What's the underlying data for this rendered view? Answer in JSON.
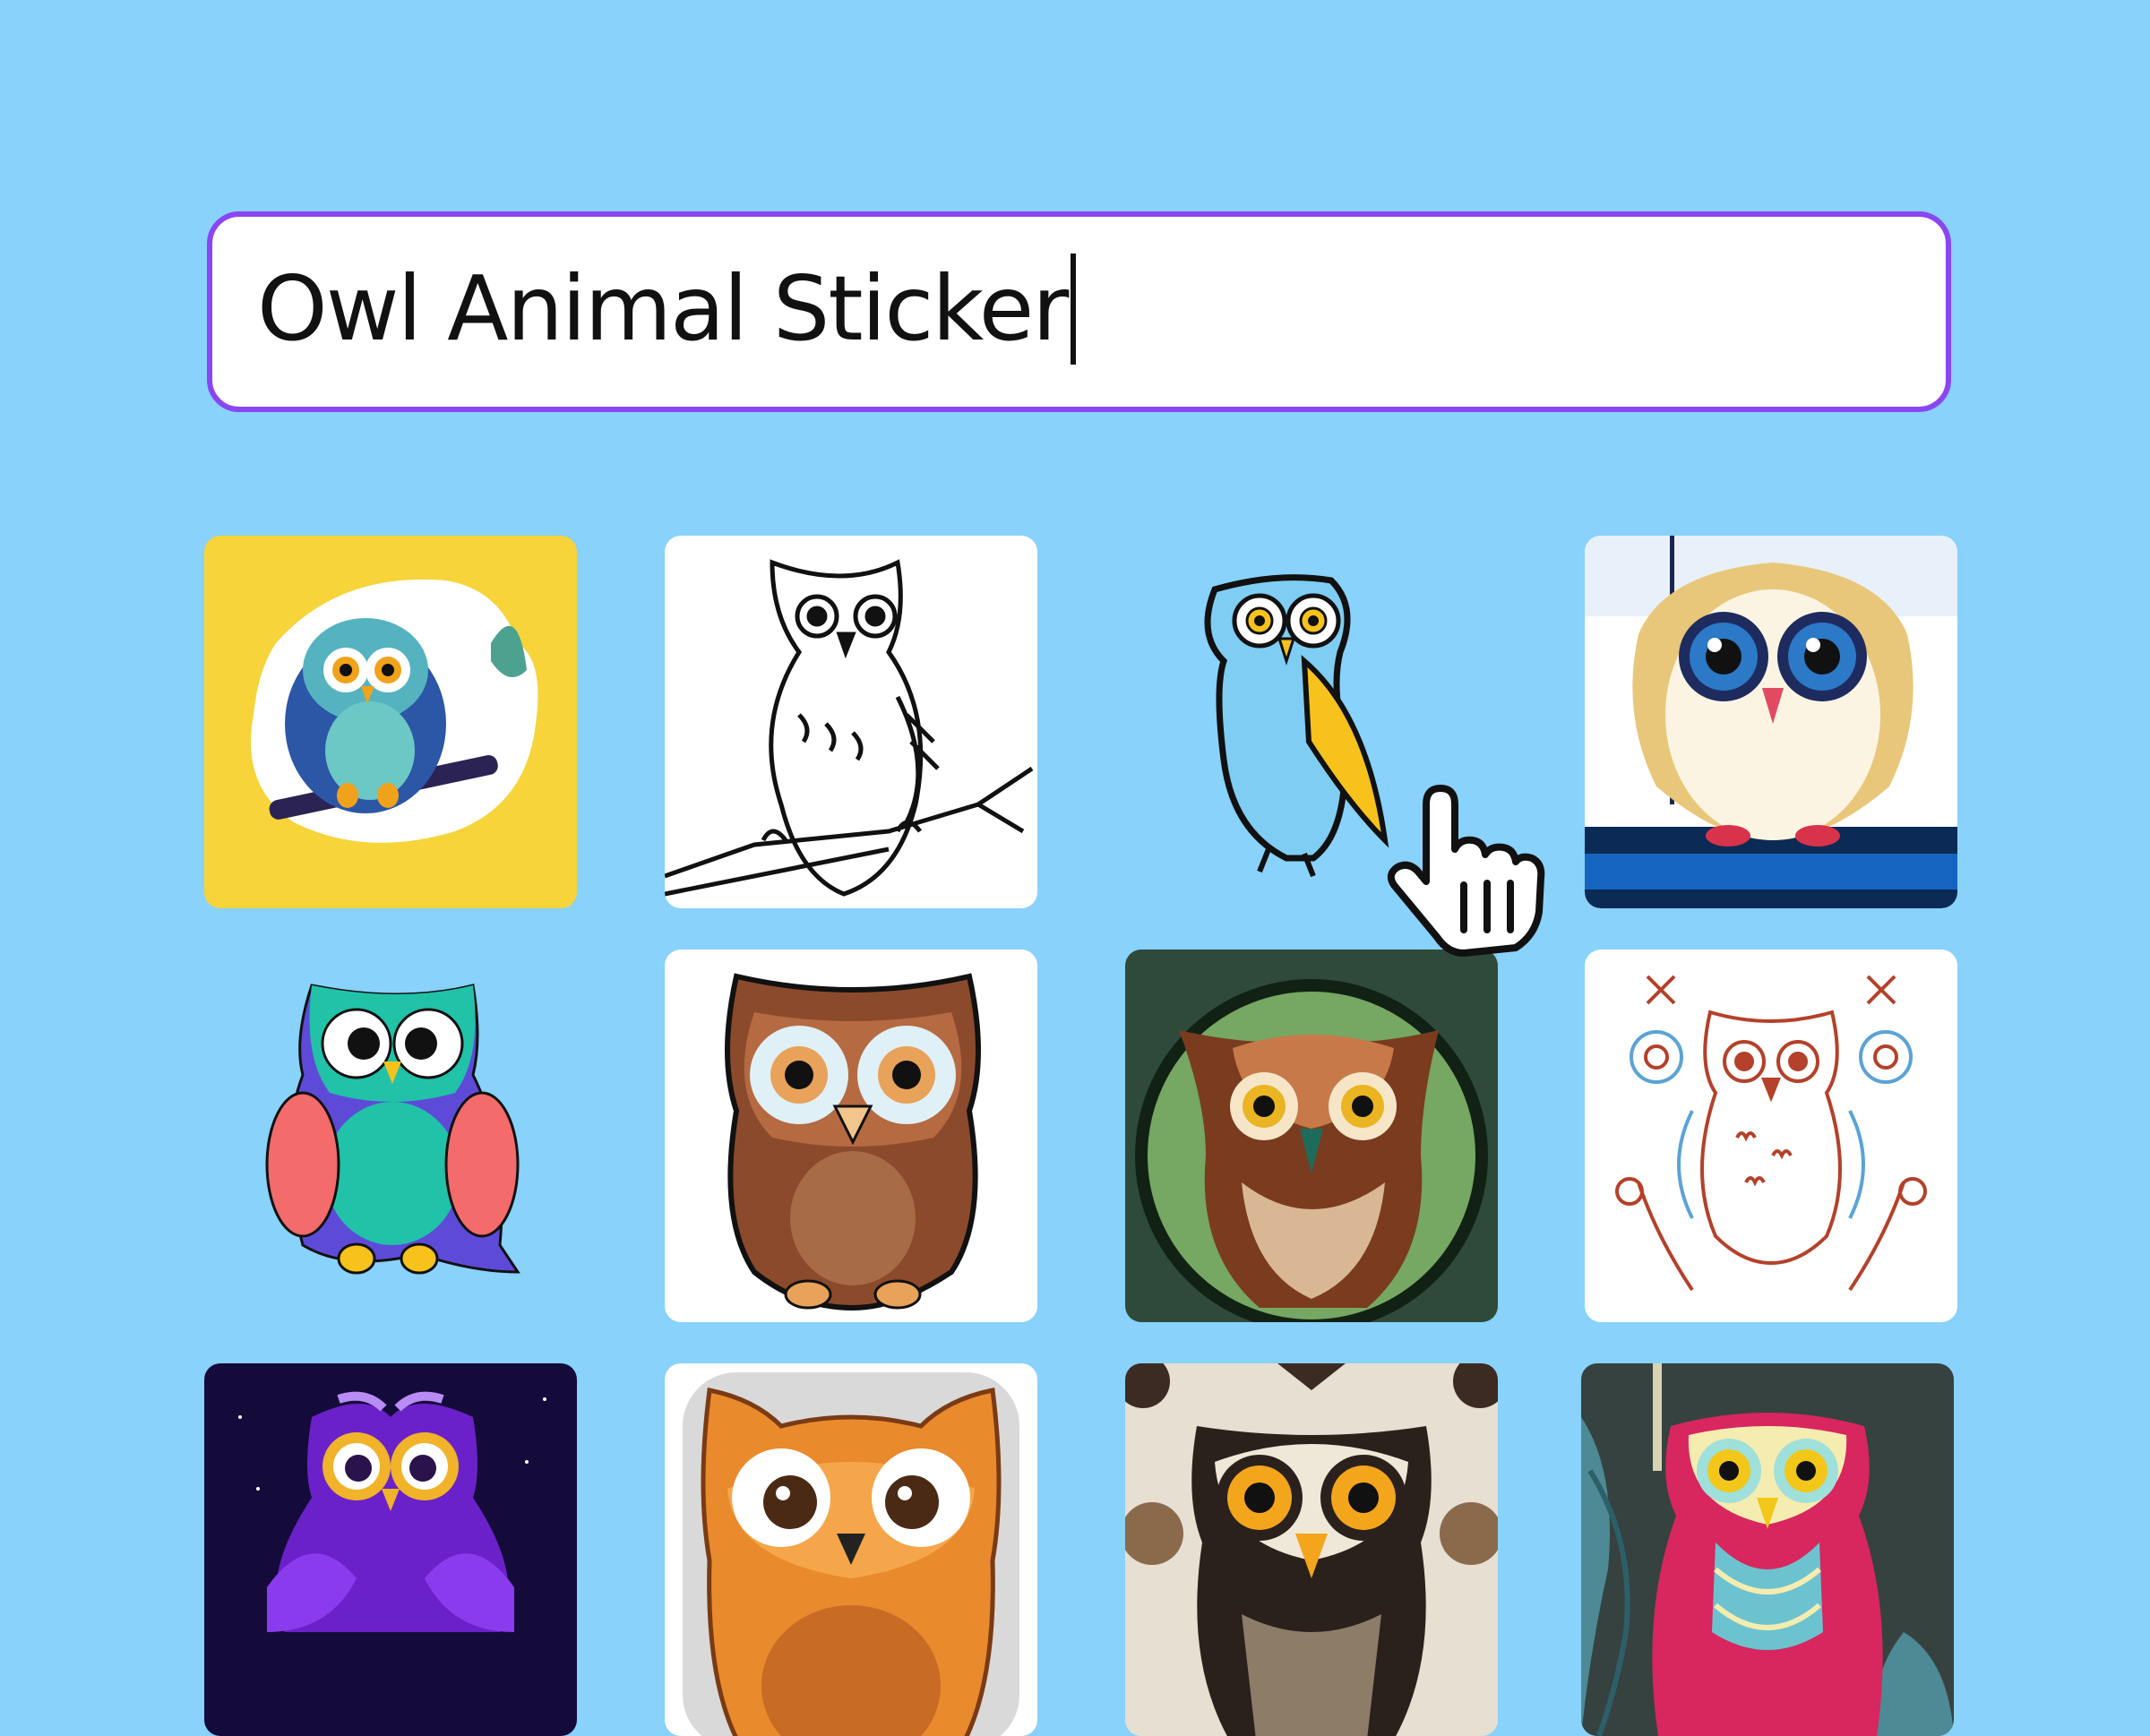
{
  "search": {
    "query": "Owl Animal Sticker"
  },
  "results": [
    {
      "icon": "owl-sticker-blue-on-yellow-icon"
    },
    {
      "icon": "owl-line-art-on-branch-icon"
    },
    {
      "icon": "owl-blue-yellow-perched-icon"
    },
    {
      "icon": "owl-beige-big-eyes-icon"
    },
    {
      "icon": "owl-teal-purple-cartoon-icon"
    },
    {
      "icon": "owl-brown-cartoon-icon"
    },
    {
      "icon": "owl-realistic-circle-badge-icon"
    },
    {
      "icon": "owl-folk-art-ornamental-icon"
    },
    {
      "icon": "owl-purple-night-icon"
    },
    {
      "icon": "owl-orange-cartoon-icon"
    },
    {
      "icon": "owl-geometric-portrait-icon"
    },
    {
      "icon": "owl-pink-teal-leaves-icon"
    }
  ],
  "colors": {
    "background": "#88d2fc",
    "search_border": "#8a46f3",
    "tile_yellow": "#f6d43a",
    "tile_green": "#2f4a3a",
    "tile_night": "#140b3a"
  },
  "cursor": {
    "icon": "hand-pointer-cursor-icon"
  }
}
